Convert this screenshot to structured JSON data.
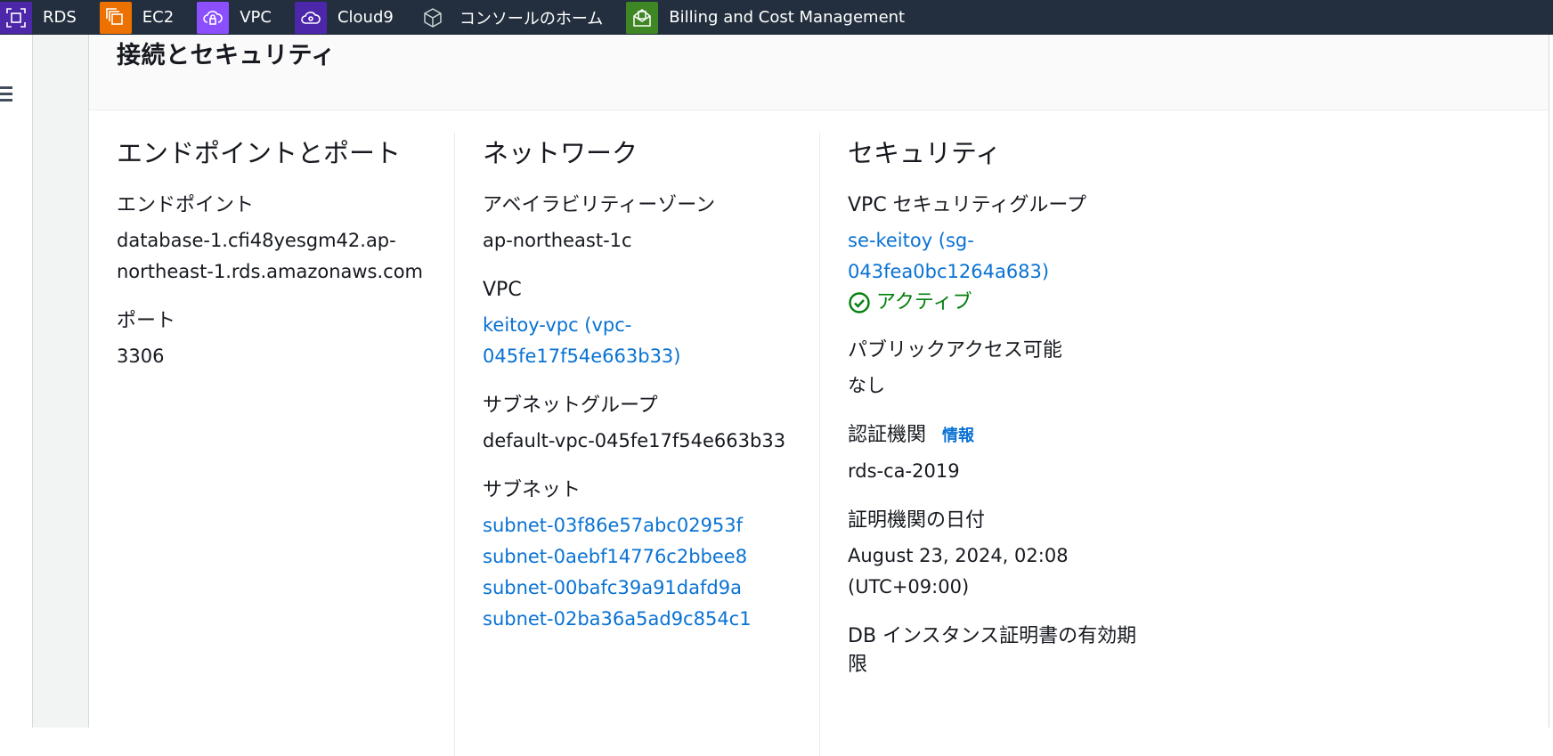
{
  "topbar": {
    "favorites": [
      {
        "label": "RDS",
        "icon": "rds-icon",
        "color": "#4d27aa"
      },
      {
        "label": "EC2",
        "icon": "ec2-icon",
        "color": "#ed7100"
      },
      {
        "label": "VPC",
        "icon": "vpc-icon",
        "color": "#8c4fff"
      },
      {
        "label": "Cloud9",
        "icon": "cloud9-icon",
        "color": "#4d27aa"
      },
      {
        "label": "コンソールのホーム",
        "icon": "console-home-icon",
        "color": "#232f3e"
      },
      {
        "label": "Billing and Cost Management",
        "icon": "billing-icon",
        "color": "#3f8624"
      }
    ]
  },
  "card": {
    "title": "接続とセキュリティ",
    "endpoint_port": {
      "heading": "エンドポイントとポート",
      "endpoint_label": "エンドポイント",
      "endpoint_line1": "database-1.cfi48yesgm42.ap-",
      "endpoint_line2": "northeast-1.rds.amazonaws.com",
      "port_label": "ポート",
      "port_value": "3306"
    },
    "network": {
      "heading": "ネットワーク",
      "az_label": "アベイラビリティーゾーン",
      "az_value": "ap-northeast-1c",
      "vpc_label": "VPC",
      "vpc_line1": "keitoy-vpc (vpc-",
      "vpc_line2": "045fe17f54e663b33)",
      "subnet_group_label": "サブネットグループ",
      "subnet_group_value": "default-vpc-045fe17f54e663b33",
      "subnets_label": "サブネット",
      "subnets": [
        "subnet-03f86e57abc02953f",
        "subnet-0aebf14776c2bbee8",
        "subnet-00bafc39a91dafd9a",
        "subnet-02ba36a5ad9c854c1"
      ]
    },
    "security": {
      "heading": "セキュリティ",
      "sg_label": "VPC セキュリティグループ",
      "sg_line1": "se-keitoy (sg-",
      "sg_line2": "043fea0bc1264a683)",
      "sg_status": "アクティブ",
      "public_label": "パブリックアクセス可能",
      "public_value": "なし",
      "ca_label": "認証機関",
      "ca_info": "情報",
      "ca_value": "rds-ca-2019",
      "ca_date_label": "証明機関の日付",
      "ca_date_line1": "August 23, 2024, 02:08",
      "ca_date_line2": "(UTC+09:00)",
      "cert_expiry_label": "DB インスタンス証明書の有効期",
      "cert_expiry_label_cont": "限"
    },
    "colors": {
      "link": "#0972d3",
      "success": "#037f0c"
    }
  }
}
